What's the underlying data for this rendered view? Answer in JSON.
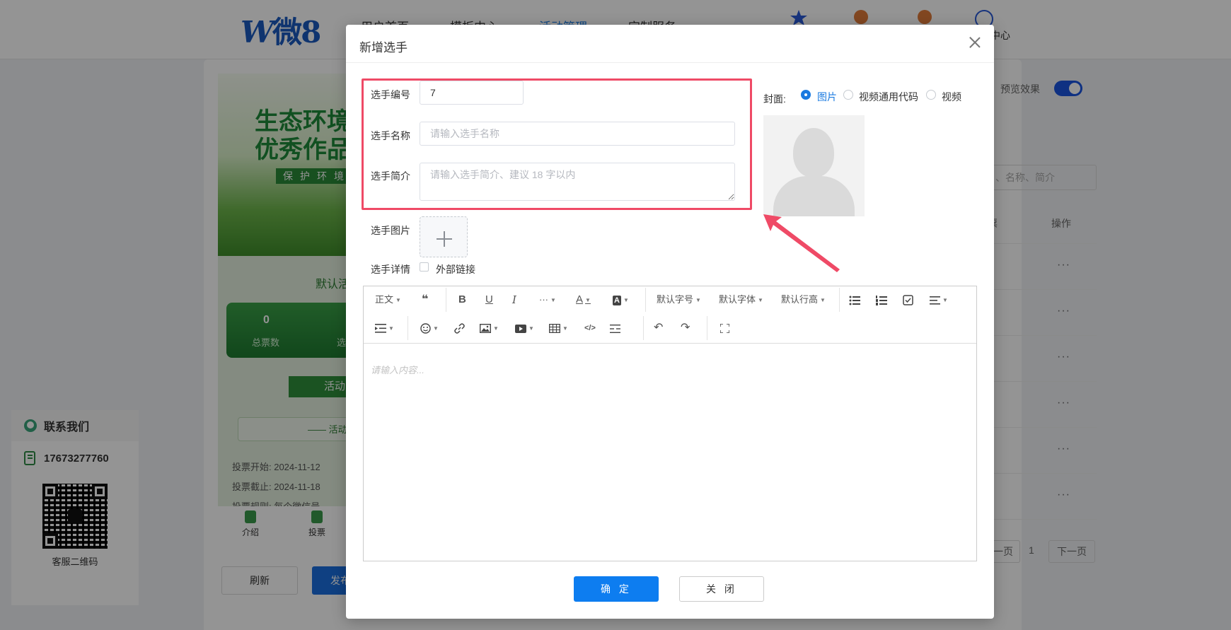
{
  "header": {
    "logo_w": "W",
    "logo_text": "微8",
    "nav": [
      "用户首页",
      "模板中心",
      "活动管理",
      "定制服务"
    ],
    "active_nav_index": 2,
    "user_label": "中心"
  },
  "preview": {
    "title_line1": "生态环境",
    "title_line2": "优秀作品",
    "subtitle": "保护环境",
    "default_text": "默认活",
    "total_votes_num": "0",
    "total_votes_label": "总票数",
    "second_stat_label": "选",
    "activity_tag": "活动",
    "activity_box": "—— 活动",
    "vote_start": "投票开始:  2024-11-12",
    "vote_end": "投票截止:  2024-11-18",
    "vote_rule": "投票规则:  每个微信号",
    "footer_intro": "介绍",
    "footer_vote": "投票"
  },
  "page_buttons": {
    "refresh": "刷新",
    "publish": "发布"
  },
  "right_panel": {
    "preview_effect": "预览效果",
    "search_placeholder": "、名称、简介",
    "col_stub": "票",
    "col_ops": "操作",
    "row_action": "···",
    "pager_prev": "上一页",
    "pager_page": "1",
    "pager_next": "下一页"
  },
  "contact": {
    "title": "联系我们",
    "phone": "17673277760",
    "qr_label": "客服二维码"
  },
  "modal": {
    "title": "新增选手",
    "fields": {
      "number_label": "选手编号",
      "number_value": "7",
      "name_label": "选手名称",
      "name_placeholder": "请输入选手名称",
      "intro_label": "选手简介",
      "intro_placeholder": "请输入选手简介、建议 18 字以内",
      "image_label": "选手图片",
      "detail_label": "选手详情",
      "external_link_label": "外部链接"
    },
    "cover": {
      "label": "封面:",
      "options": [
        "图片",
        "视频通用代码",
        "视频"
      ],
      "selected": "图片"
    },
    "editor": {
      "toolbar": {
        "paragraph": "正文",
        "font_size": "默认字号",
        "font_family": "默认字体",
        "line_height": "默认行高"
      },
      "placeholder": "请输入内容..."
    },
    "confirm": "确 定",
    "close": "关 闭"
  },
  "colors": {
    "primary": "#0d7df0",
    "highlight": "#ef4a66",
    "overlay": "rgba(0,0,0,0.42)"
  }
}
